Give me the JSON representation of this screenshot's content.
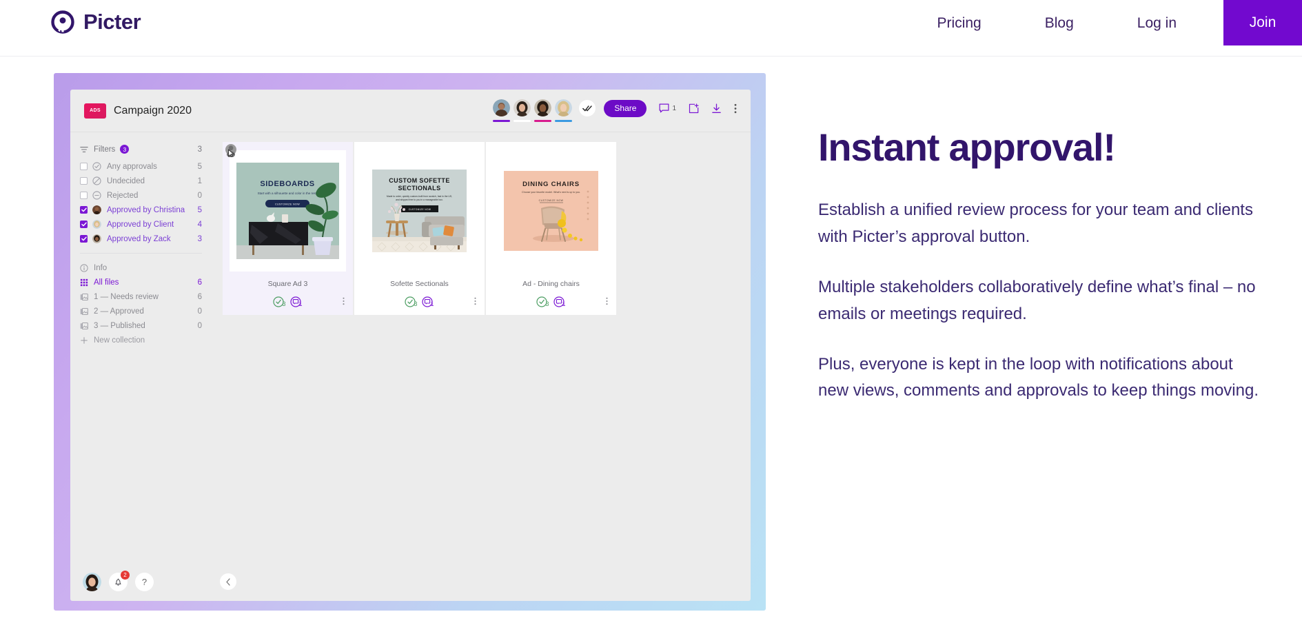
{
  "brand": {
    "name": "Picter",
    "logo_icon": "picter-circle-logo",
    "accent": "#7209cf",
    "ink": "#32156b"
  },
  "nav": {
    "links": [
      {
        "label": "Pricing",
        "name": "nav-link-pricing"
      },
      {
        "label": "Blog",
        "name": "nav-link-blog"
      },
      {
        "label": "Log in",
        "name": "nav-link-login"
      }
    ],
    "cta": {
      "label": "Join",
      "bg": "#7209cf",
      "color": "#ffffff"
    }
  },
  "app": {
    "project": {
      "title": "Campaign 2020",
      "thumb_label": "ADS"
    },
    "header": {
      "avatars": [
        {
          "name": "collaborator-1",
          "underline": "#7b18d4"
        },
        {
          "name": "collaborator-2",
          "underline": "#ffffff"
        },
        {
          "name": "collaborator-3",
          "underline": "#d81b8e"
        },
        {
          "name": "collaborator-4",
          "underline": "#3b9ae1"
        }
      ],
      "approve_all_icon": "double-check-icon",
      "share_label": "Share",
      "comment_count": "1",
      "icons": [
        "comment-icon",
        "upload-icon",
        "download-icon",
        "more-icon"
      ]
    },
    "sidebar": {
      "filters_label": "Filters",
      "filters_badge": "3",
      "filters": [
        {
          "label": "Any approvals",
          "count": "5",
          "icon": "check-circle-icon",
          "checked": false,
          "avatar": false
        },
        {
          "label": "Undecided",
          "count": "1",
          "icon": "slash-circle-icon",
          "checked": false,
          "avatar": false
        },
        {
          "label": "Rejected",
          "count": "0",
          "icon": "minus-circle-icon",
          "checked": false,
          "avatar": false
        },
        {
          "label": "Approved by Christina",
          "count": "5",
          "icon": "avatar",
          "checked": true,
          "avatar": true,
          "avatar_color": "#6d4a3a"
        },
        {
          "label": "Approved by Client",
          "count": "4",
          "icon": "avatar",
          "checked": true,
          "avatar": true,
          "avatar_color": "#d9c1a8"
        },
        {
          "label": "Approved by Zack",
          "count": "3",
          "icon": "avatar",
          "checked": true,
          "avatar": true,
          "avatar_color": "#5a4034"
        }
      ],
      "info_label": "Info",
      "all_files": {
        "label": "All files",
        "count": "6"
      },
      "collections": [
        {
          "label": "1 — Needs review",
          "count": "6"
        },
        {
          "label": "2 — Approved",
          "count": "0"
        },
        {
          "label": "3 — Published",
          "count": "0"
        }
      ],
      "new_collection_label": "New collection"
    },
    "cards": [
      {
        "caption": "Square Ad 3",
        "approvals": "3",
        "comments": "1",
        "ad": {
          "heading": "SIDEBOARDS",
          "sub": "Start with a silhouette and color in the rest.",
          "button": "CUSTOMIZE NOW",
          "bg": "#a9c4bb",
          "button_bg": "#1b2a52",
          "heading_color": "#1b2a52"
        }
      },
      {
        "caption": "Sofette Sectionals",
        "approvals": "3",
        "comments": "1",
        "ad": {
          "heading": "CUSTOM SOFETTE SECTIONALS",
          "sub": "Made to order, quickly custom-built from scratch, fast in the US, and shipped free to you in a manageable box.",
          "button": "CUSTOMIZE NOW",
          "bg": "#c9d3d2",
          "button_bg": "#16181a",
          "heading_color": "#16181a"
        }
      },
      {
        "caption": "Ad - Dining chairs",
        "approvals": "3",
        "comments": "1",
        "ad": {
          "heading": "DINING CHAIRS",
          "sub": "Choose your favorite model. What's next is up to you.",
          "button": "CUSTOMIZE NOW",
          "bg": "#f3c4ac",
          "button_bg": "transparent",
          "heading_color": "#2a2320"
        }
      }
    ],
    "footer": {
      "notification_count": "2",
      "help_label": "?",
      "collapse_icon": "chevron-left-icon"
    }
  },
  "copy": {
    "heading": "Instant approval!",
    "paragraphs": [
      "Establish a unified review process for your team and clients with Picter’s approval button.",
      "Multiple stakeholders collaboratively define what’s final – no emails or meetings required.",
      "Plus, everyone is kept in the loop with notifications about new views, comments and approvals to keep things moving."
    ]
  }
}
